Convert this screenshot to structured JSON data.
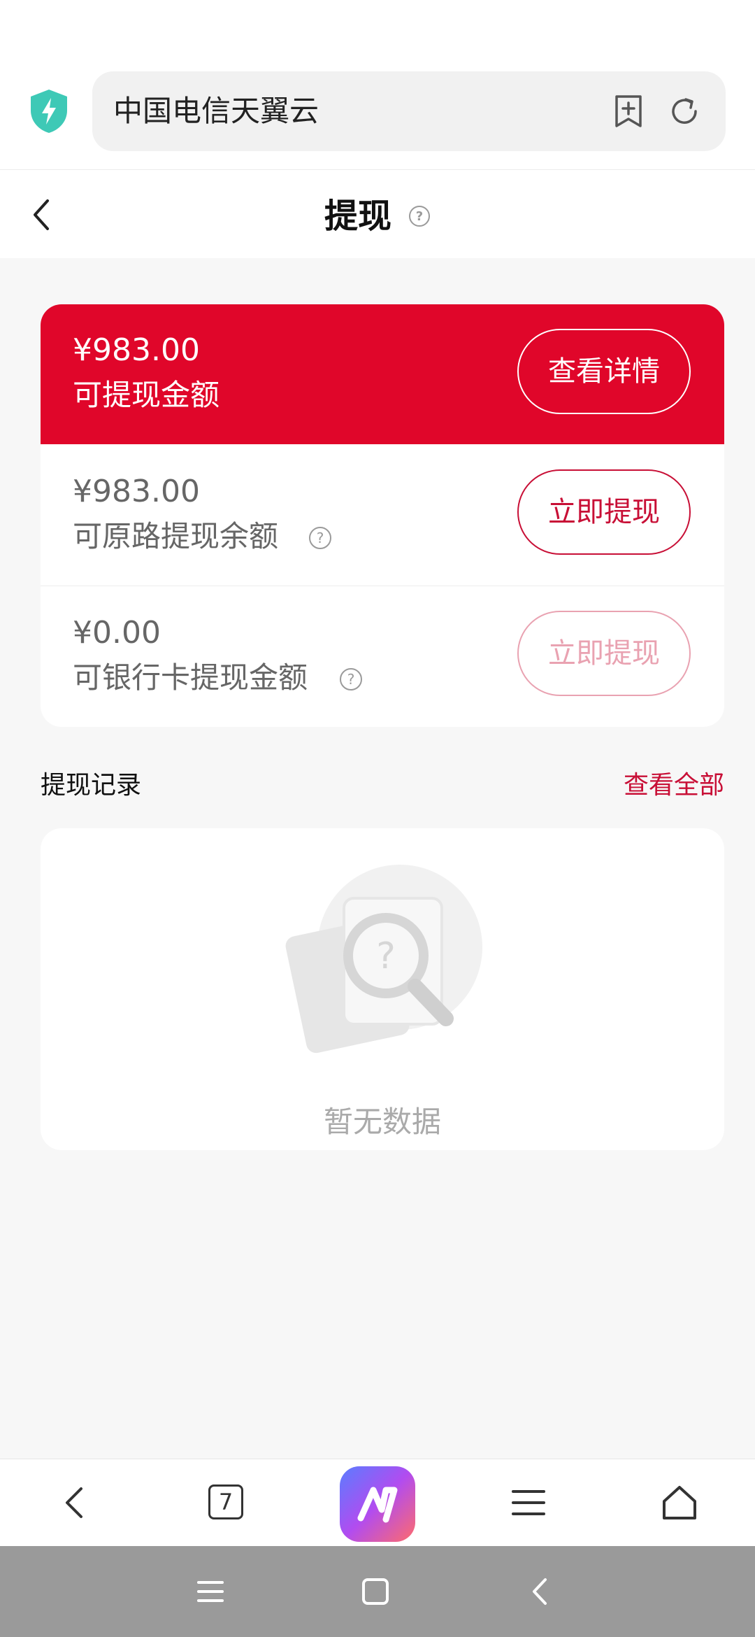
{
  "browser": {
    "url_title": "中国电信天翼云"
  },
  "header": {
    "title": "提现"
  },
  "balance": {
    "top": {
      "amount": "¥983.00",
      "label": "可提现金额",
      "button": "查看详情"
    },
    "rows": [
      {
        "amount": "¥983.00",
        "label": "可原路提现余额",
        "button": "立即提现",
        "enabled": true
      },
      {
        "amount": "¥0.00",
        "label": "可银行卡提现金额",
        "button": "立即提现",
        "enabled": false
      }
    ]
  },
  "records": {
    "title": "提现记录",
    "view_all": "查看全部",
    "empty_text": "暂无数据"
  },
  "bottom_nav": {
    "tabs_count": "7"
  },
  "colors": {
    "brand_red": "#e0062a",
    "accent_red": "#c80f36",
    "shield_teal": "#3ec9b6"
  }
}
